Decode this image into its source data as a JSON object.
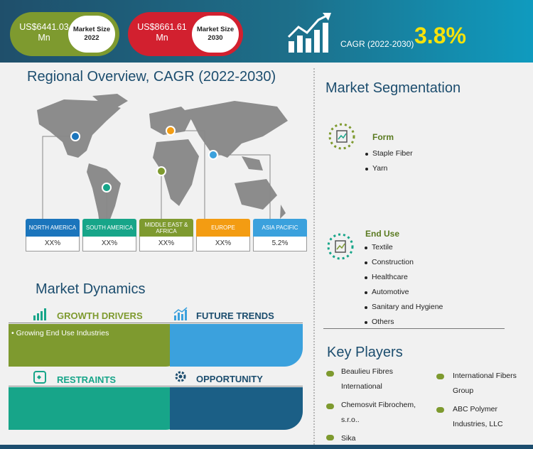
{
  "header": {
    "market_2022": {
      "value": "US$6441.03 Mn",
      "label": "Market Size 2022"
    },
    "market_2030": {
      "value": "US$8661.61 Mn",
      "label": "Market Size 2030"
    },
    "cagr_label": "CAGR (2022-2030)",
    "cagr_value": "3.8%",
    "colors": {
      "green": "#7e9a2f",
      "red": "#d2202f",
      "yellow": "#f7e20a"
    }
  },
  "regional": {
    "title_a": "Regional",
    "title_b": "Overview, CAGR (2022-2030)",
    "regions": [
      {
        "name": "NORTH AMERICA",
        "value": "XX%",
        "color": "#1b75bc"
      },
      {
        "name": "SOUTH AMERICA",
        "value": "XX%",
        "color": "#17a589"
      },
      {
        "name": "MIDDLE EAST & AFRICA",
        "value": "XX%",
        "color": "#7e9a2f"
      },
      {
        "name": "EUROPE",
        "value": "XX%",
        "color": "#f39c12"
      },
      {
        "name": "ASIA PACIFIC",
        "value": "5.2%",
        "color": "#3ba1dd"
      }
    ]
  },
  "dynamics": {
    "title_a": "Market",
    "title_b": "Dynamics",
    "growth_drivers": {
      "label": "GROWTH DRIVERS",
      "items": [
        "Growing End Use Industries"
      ]
    },
    "future_trends": {
      "label": "FUTURE TRENDS"
    },
    "restraints": {
      "label": "RESTRAINTS"
    },
    "opportunity": {
      "label": "OPPORTUNITY"
    }
  },
  "segmentation": {
    "title_a": "Market",
    "title_b": "Segmentation",
    "form": {
      "label": "Form",
      "items": [
        "Staple Fiber",
        "Yarn"
      ]
    },
    "end_use": {
      "label": "End Use",
      "items": [
        "Textile",
        "Construction",
        "Healthcare",
        "Automotive",
        "Sanitary and Hygiene",
        "Others"
      ]
    }
  },
  "key_players": {
    "title": "Key Players",
    "col1": [
      "Beaulieu Fibres International",
      "Chemosvit Fibrochem, s.r.o..",
      "Sika"
    ],
    "col2": [
      "International Fibers Group",
      "ABC Polymer Industries, LLC"
    ]
  }
}
